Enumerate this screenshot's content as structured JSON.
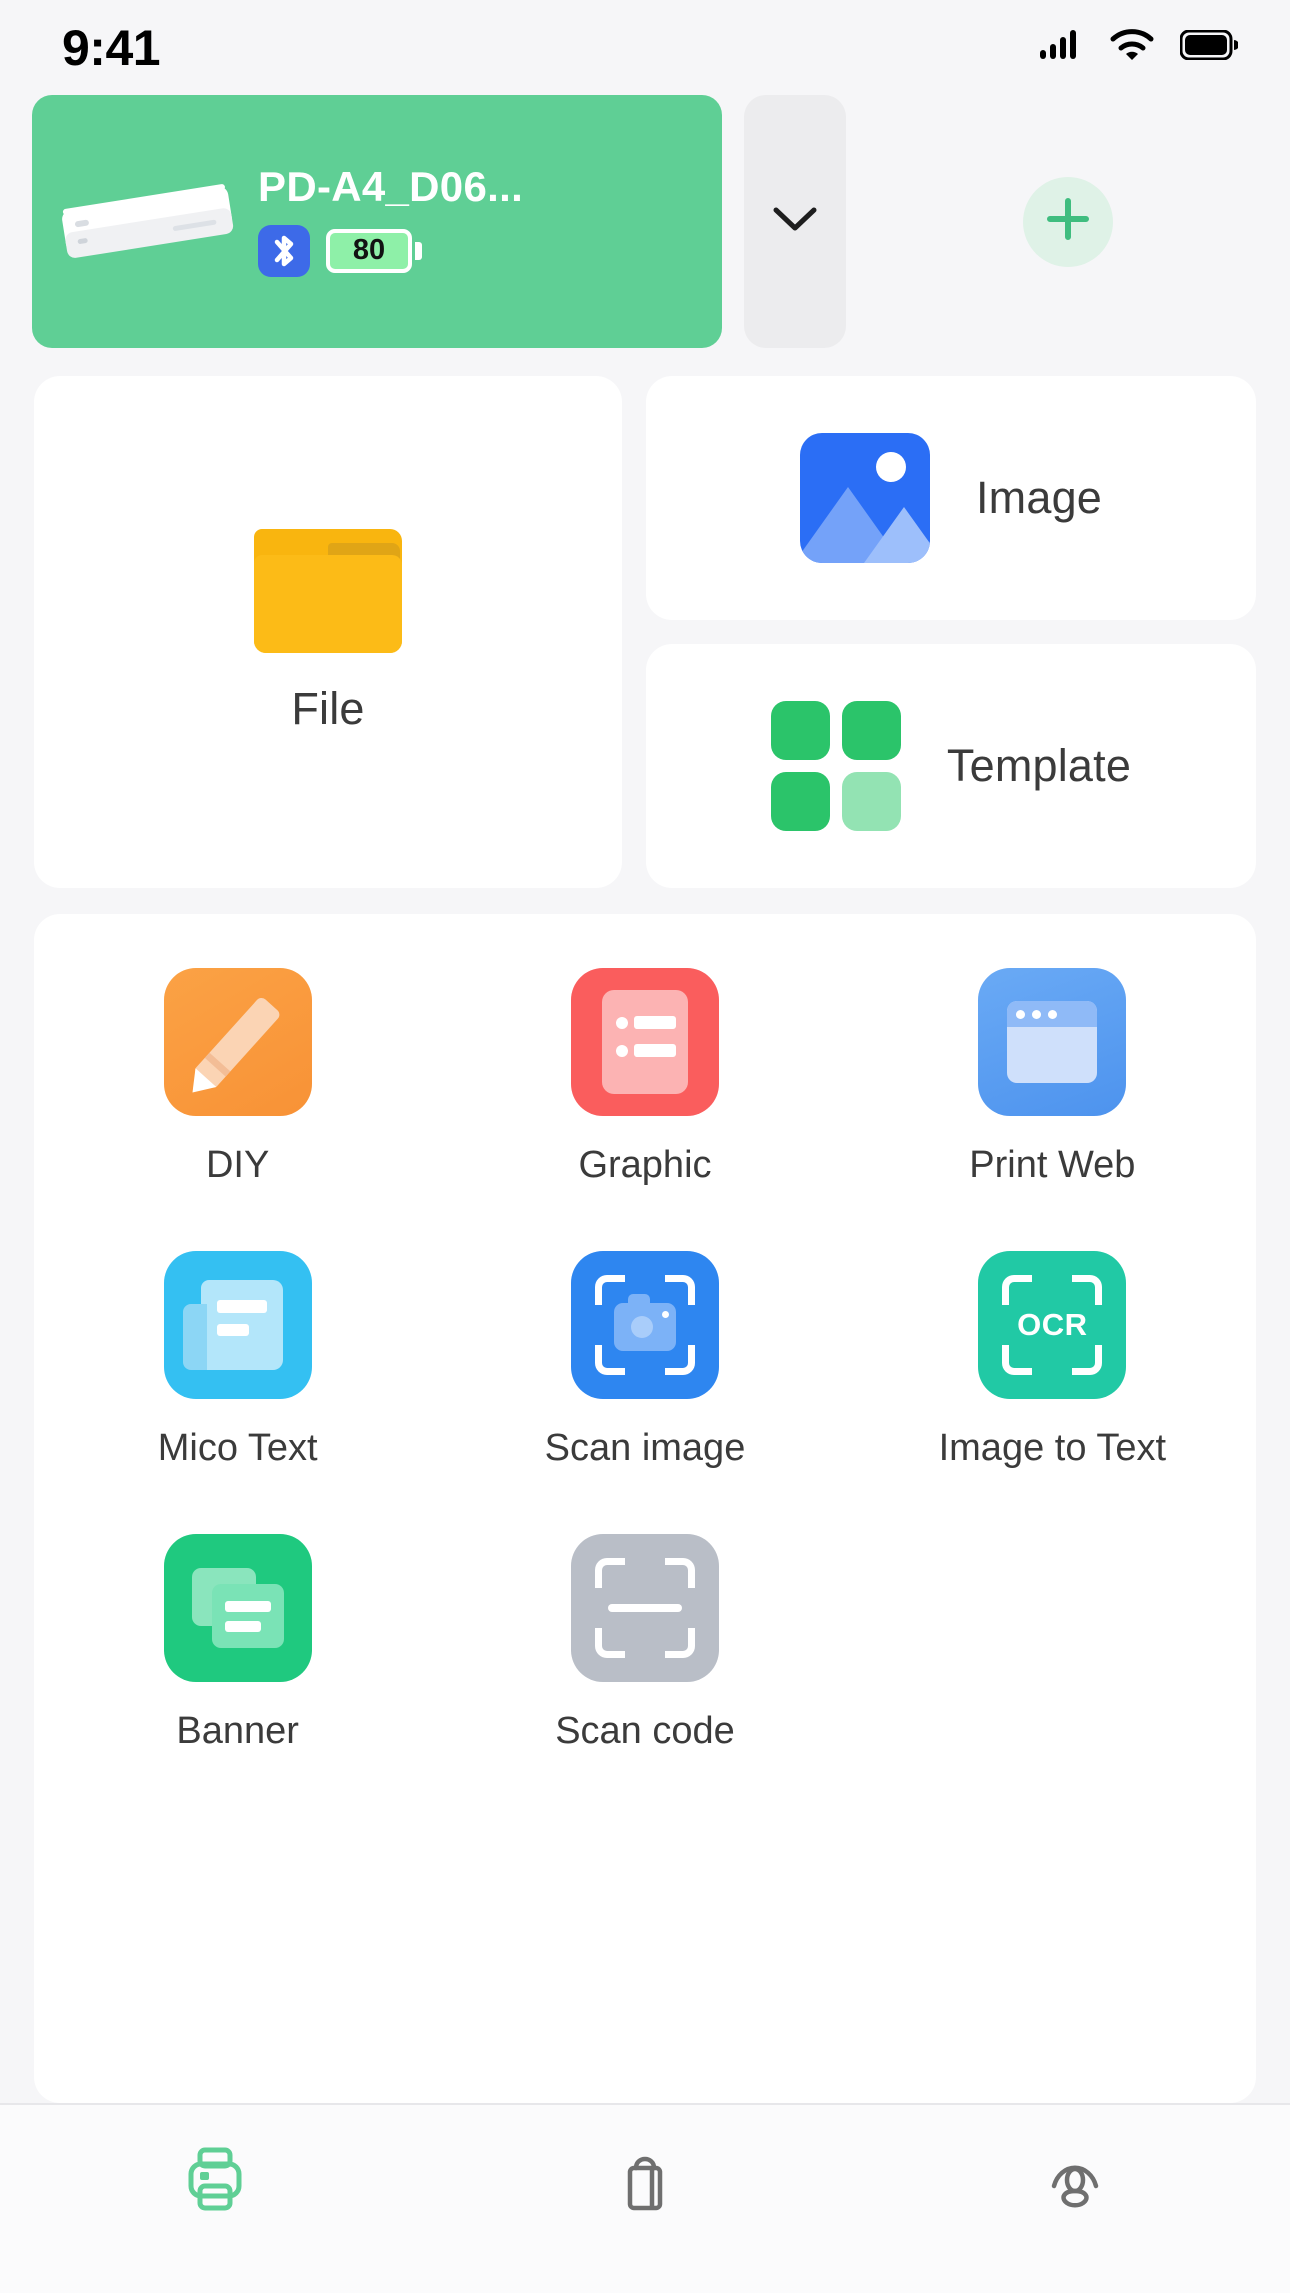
{
  "status_bar": {
    "time": "9:41",
    "icons": [
      "cellular-signal-icon",
      "wifi-icon",
      "battery-icon"
    ]
  },
  "device": {
    "name": "PD-A4_D06...",
    "printer_image": "printer-device-illustration",
    "bluetooth_icon": "bluetooth-icon",
    "battery_level": "80",
    "expand_icon": "chevron-down-icon",
    "add_icon": "plus-icon",
    "card_color": "#5fcf95",
    "accent_color": "#2bc46a"
  },
  "quick_actions": [
    {
      "label": "File",
      "icon": "folder-icon",
      "color": "#fcbb17"
    },
    {
      "label": "Image",
      "icon": "picture-icon",
      "color": "#2b6ef5"
    },
    {
      "label": "Template",
      "icon": "grid-squares-icon",
      "color": "#2bc46a"
    }
  ],
  "tools": [
    {
      "label": "DIY",
      "icon": "pencil-icon",
      "color": "#f89236"
    },
    {
      "label": "Graphic",
      "icon": "list-document-icon",
      "color": "#fa5d5d"
    },
    {
      "label": "Print Web",
      "icon": "browser-window-icon",
      "color": "#4d93ee"
    },
    {
      "label": "Mico Text",
      "icon": "book-text-icon",
      "color": "#34c0f2"
    },
    {
      "label": "Scan image",
      "icon": "scan-camera-icon",
      "color": "#2e86f0"
    },
    {
      "label": "Image to Text",
      "icon": "ocr-scan-icon",
      "color": "#21c9a5",
      "badge_text": "OCR"
    },
    {
      "label": "Banner",
      "icon": "banner-cards-icon",
      "color": "#1fc97f"
    },
    {
      "label": "Scan code",
      "icon": "scan-code-icon",
      "color": "#b9bec7"
    }
  ],
  "tab_bar": {
    "items": [
      {
        "icon": "printer-icon",
        "active": true,
        "color": "#5fcf95"
      },
      {
        "icon": "shopping-bag-icon",
        "active": false,
        "color": "#6f6f6f"
      },
      {
        "icon": "user-profile-icon",
        "active": false,
        "color": "#6f6f6f"
      }
    ]
  }
}
